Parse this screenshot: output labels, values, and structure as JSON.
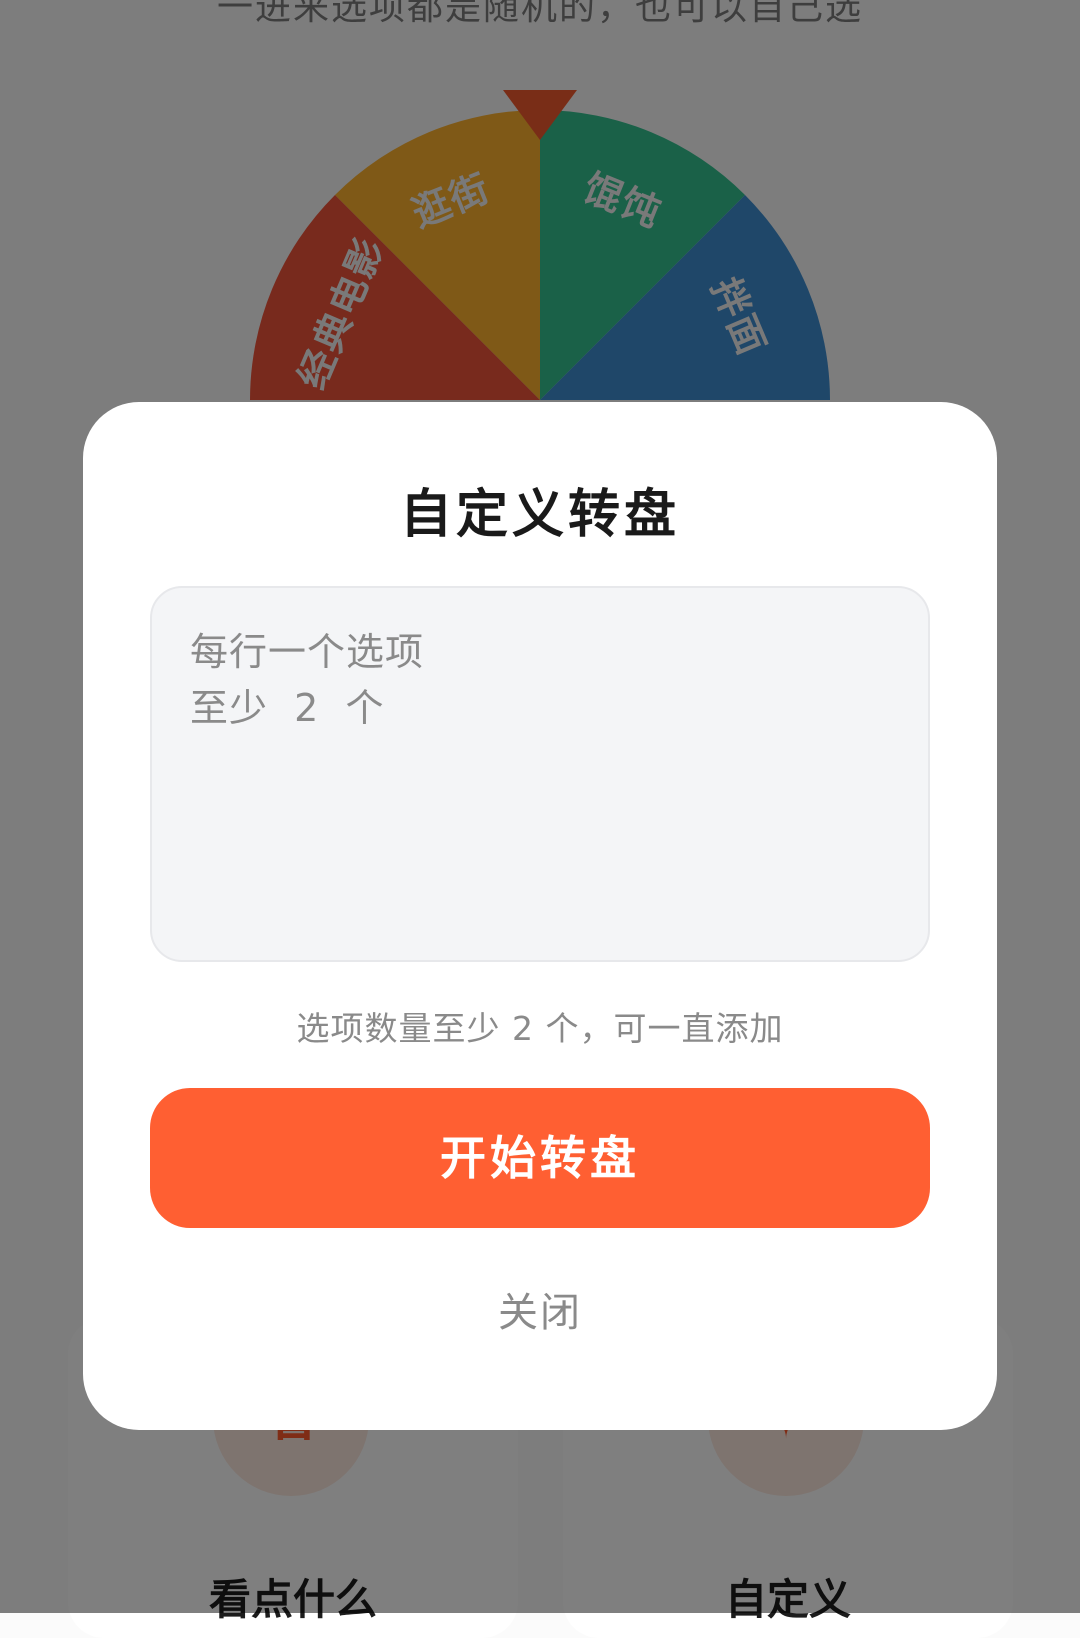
{
  "page": {
    "hint": "一进来选项都是随机的，也可以自己选"
  },
  "wheel": {
    "segments": [
      {
        "label": "经典电影",
        "color": "#f0553a"
      },
      {
        "label": "逛街",
        "color": "#ffb22e"
      },
      {
        "label": "馄饨",
        "color": "#35c291"
      },
      {
        "label": "拌面",
        "color": "#3f8fd2"
      }
    ],
    "pointer_color": "#f25a2e"
  },
  "dialog": {
    "title": "自定义转盘",
    "placeholder_line_1": "每行一个选项",
    "placeholder_line_2": "至少  2  个",
    "note": "选项数量至少 2 个，可一直添加",
    "start_button": "开始转盘",
    "close": "关闭"
  },
  "bottom_cards": [
    {
      "icon": "看",
      "title": "看点什么"
    },
    {
      "icon": "✦",
      "title": "自定义"
    }
  ],
  "colors": {
    "accent": "#ff5f32",
    "overlay": "rgba(0,0,0,0.5)"
  }
}
